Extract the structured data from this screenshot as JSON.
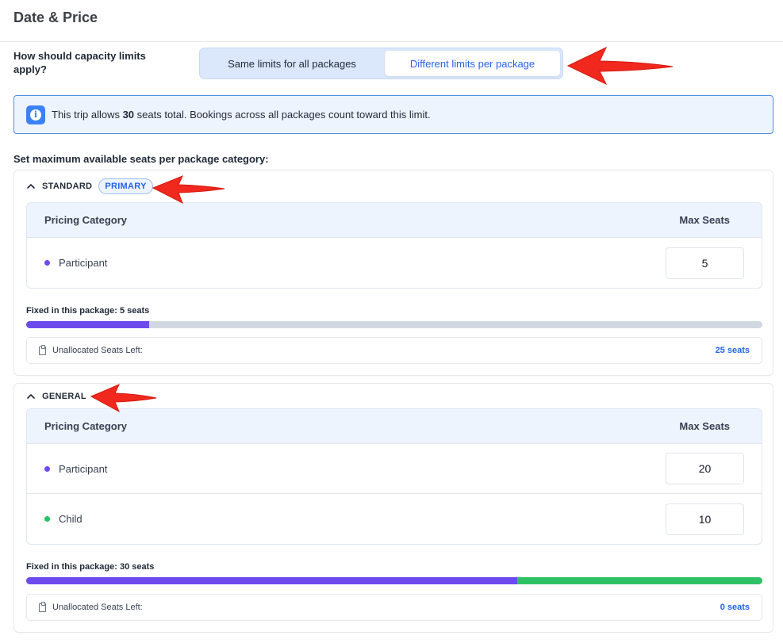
{
  "page": {
    "title": "Date & Price"
  },
  "capacity": {
    "question": "How should capacity limits apply?",
    "options": [
      {
        "label": "Same limits for all packages",
        "selected": false
      },
      {
        "label": "Different limits per package",
        "selected": true
      }
    ]
  },
  "info": {
    "prefix": "This trip allows ",
    "seats": "30",
    "suffix": " seats total. Bookings across all packages count toward this limit.",
    "icon": "info-icon"
  },
  "section_heading": "Set maximum available seats per package category:",
  "packages": [
    {
      "name": "STANDARD",
      "badge": "PRIMARY",
      "table_headers": {
        "category": "Pricing Category",
        "seats": "Max Seats"
      },
      "rows": [
        {
          "category": "Participant",
          "dot_color": "#6d4aed",
          "max_seats": "5"
        }
      ],
      "fixed_label": "Fixed in this package: 5 seats",
      "progress": [
        {
          "fraction": 0.1667,
          "color": "#6d4aed"
        }
      ],
      "unallocated_label": "Unallocated Seats Left:",
      "unallocated_value": "25 seats"
    },
    {
      "name": "GENERAL",
      "table_headers": {
        "category": "Pricing Category",
        "seats": "Max Seats"
      },
      "rows": [
        {
          "category": "Participant",
          "dot_color": "#6d4aed",
          "max_seats": "20"
        },
        {
          "category": "Child",
          "dot_color": "#22c55e",
          "max_seats": "10"
        }
      ],
      "fixed_label": "Fixed in this package: 30 seats",
      "progress": [
        {
          "fraction": 0.6667,
          "color": "#6d4aed"
        },
        {
          "fraction": 0.3333,
          "color": "#2fc166"
        }
      ],
      "unallocated_label": "Unallocated Seats Left:",
      "unallocated_value": "0 seats"
    }
  ],
  "colors": {
    "accent": "#2563eb",
    "arrow": "#f0281e"
  }
}
